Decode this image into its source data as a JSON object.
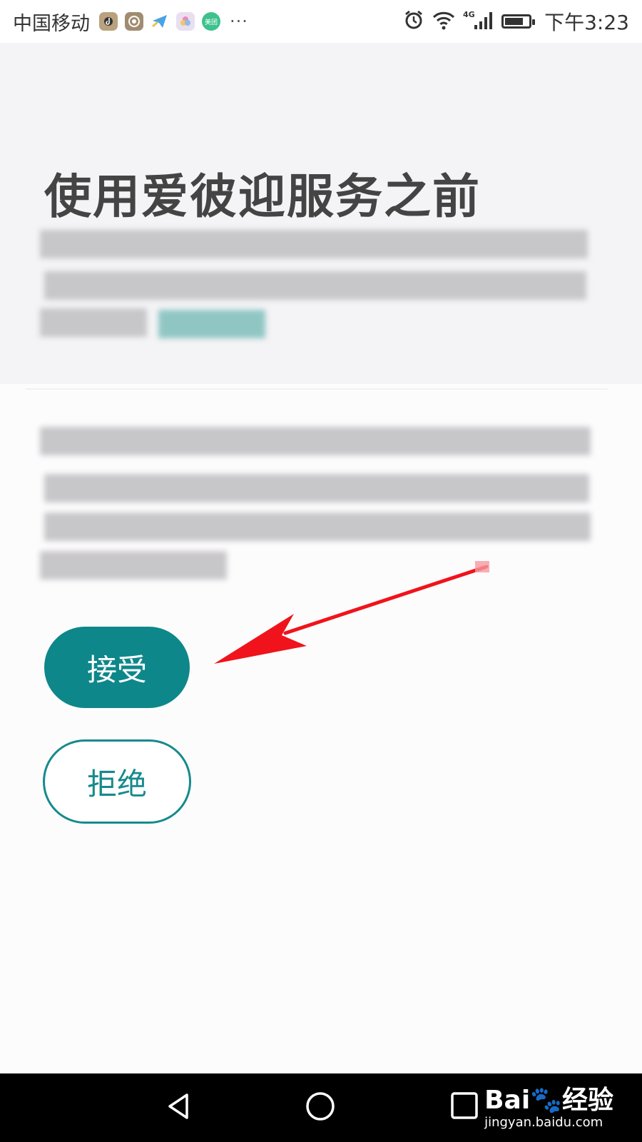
{
  "status_bar": {
    "carrier": "中国移动",
    "notification_icons": [
      "tiktok-icon",
      "app-icon",
      "telegram-icon",
      "flower-app-icon",
      "meituan-icon"
    ],
    "meituan_label": "美团",
    "more": "···",
    "network_label": "4G",
    "time": "下午3:23"
  },
  "dialog": {
    "title": "使用爱彼迎服务之前"
  },
  "buttons": {
    "accept": "接受",
    "reject": "拒绝"
  },
  "annotation": {
    "arrow_color": "#f0131b"
  },
  "colors": {
    "accent": "#0e878a",
    "header_bg": "#f4f3f5"
  },
  "watermark": {
    "logo": "Bai🐾经验",
    "url": "jingyan.baidu.com"
  }
}
